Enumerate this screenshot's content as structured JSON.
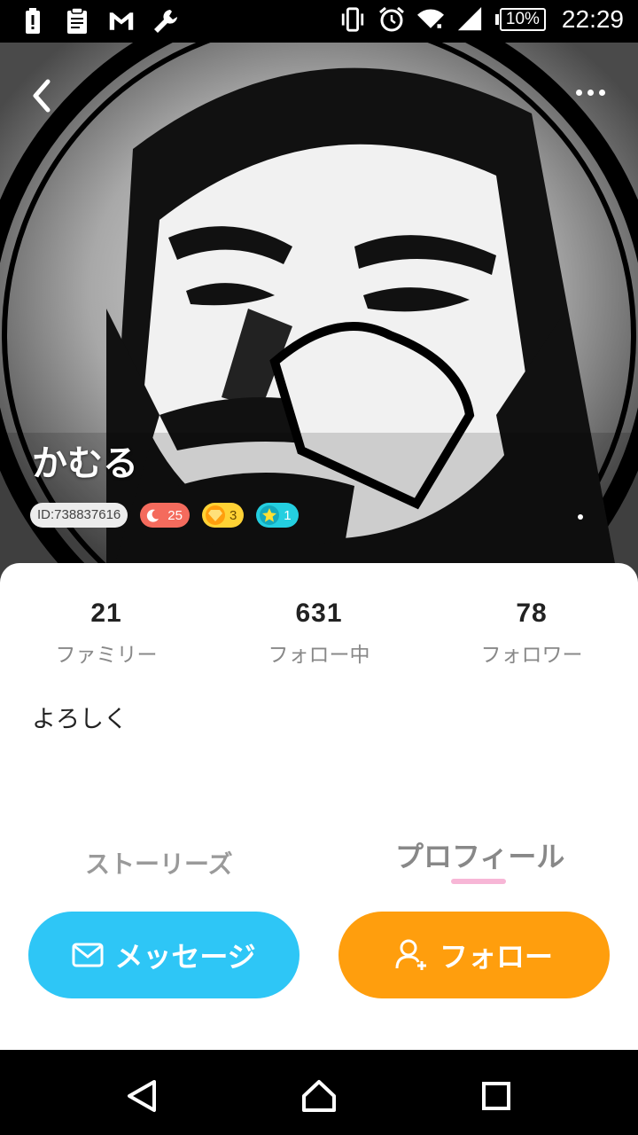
{
  "status_bar": {
    "time": "22:29",
    "battery": "10%",
    "left_icons": [
      "battery-alert-icon",
      "clipboard-icon",
      "gmail-icon",
      "wrench-icon"
    ],
    "right_icons": [
      "vibrate-icon",
      "alarm-icon",
      "wifi-icon",
      "signal-icon"
    ]
  },
  "header": {
    "back_icon": "chevron-left-icon",
    "more_icon": "more-horizontal-icon"
  },
  "profile": {
    "name": "かむる",
    "id_label": "ID:738837616",
    "badges": [
      {
        "icon": "moon-icon",
        "value": "25",
        "color": "#f46b5d"
      },
      {
        "icon": "diamond-icon",
        "value": "3",
        "color": "#ffd235"
      },
      {
        "icon": "star-icon",
        "value": "1",
        "color": "#24cfe0"
      }
    ],
    "bio": "よろしく"
  },
  "stats": [
    {
      "value": "21",
      "label": "ファミリー"
    },
    {
      "value": "631",
      "label": "フォロー中"
    },
    {
      "value": "78",
      "label": "フォロワー"
    }
  ],
  "tabs": {
    "stories": "ストーリーズ",
    "profile": "プロフィール",
    "active": "profile"
  },
  "actions": {
    "message": "メッセージ",
    "follow": "フォロー",
    "message_color": "#2ec6f6",
    "follow_color": "#ff9e0d"
  },
  "nav": [
    "back-triangle-icon",
    "home-icon",
    "recents-square-icon"
  ]
}
